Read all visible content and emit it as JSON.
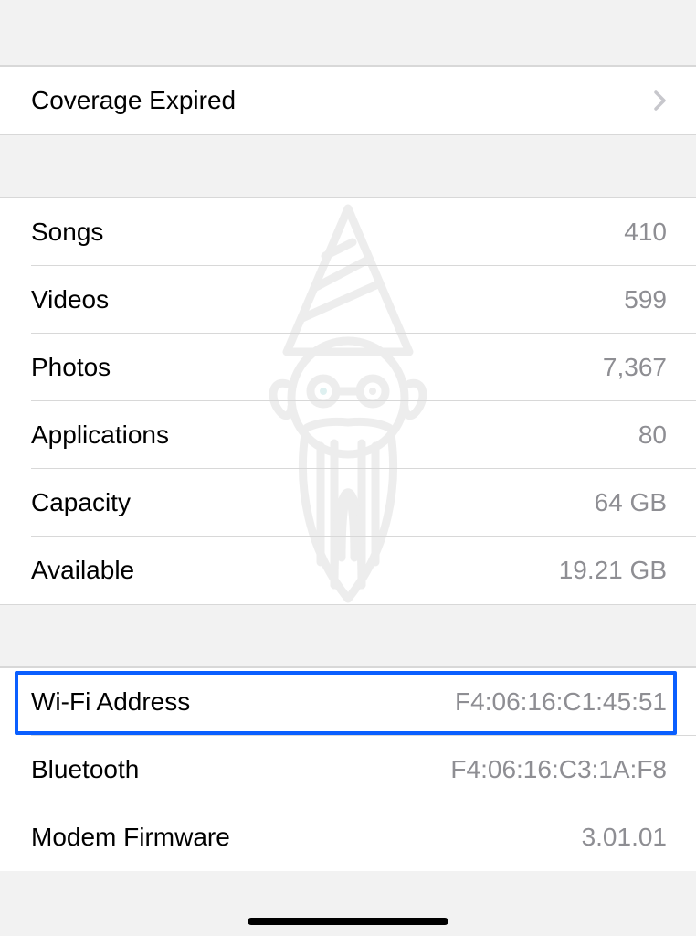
{
  "section1": {
    "coverage_label": "Coverage Expired"
  },
  "section2": {
    "songs_label": "Songs",
    "songs_value": "410",
    "videos_label": "Videos",
    "videos_value": "599",
    "photos_label": "Photos",
    "photos_value": "7,367",
    "applications_label": "Applications",
    "applications_value": "80",
    "capacity_label": "Capacity",
    "capacity_value": "64 GB",
    "available_label": "Available",
    "available_value": "19.21 GB"
  },
  "section3": {
    "wifi_label": "Wi-Fi Address",
    "wifi_value": "F4:06:16:C1:45:51",
    "bluetooth_label": "Bluetooth",
    "bluetooth_value": "F4:06:16:C3:1A:F8",
    "modem_label": "Modem Firmware",
    "modem_value": "3.01.01"
  }
}
